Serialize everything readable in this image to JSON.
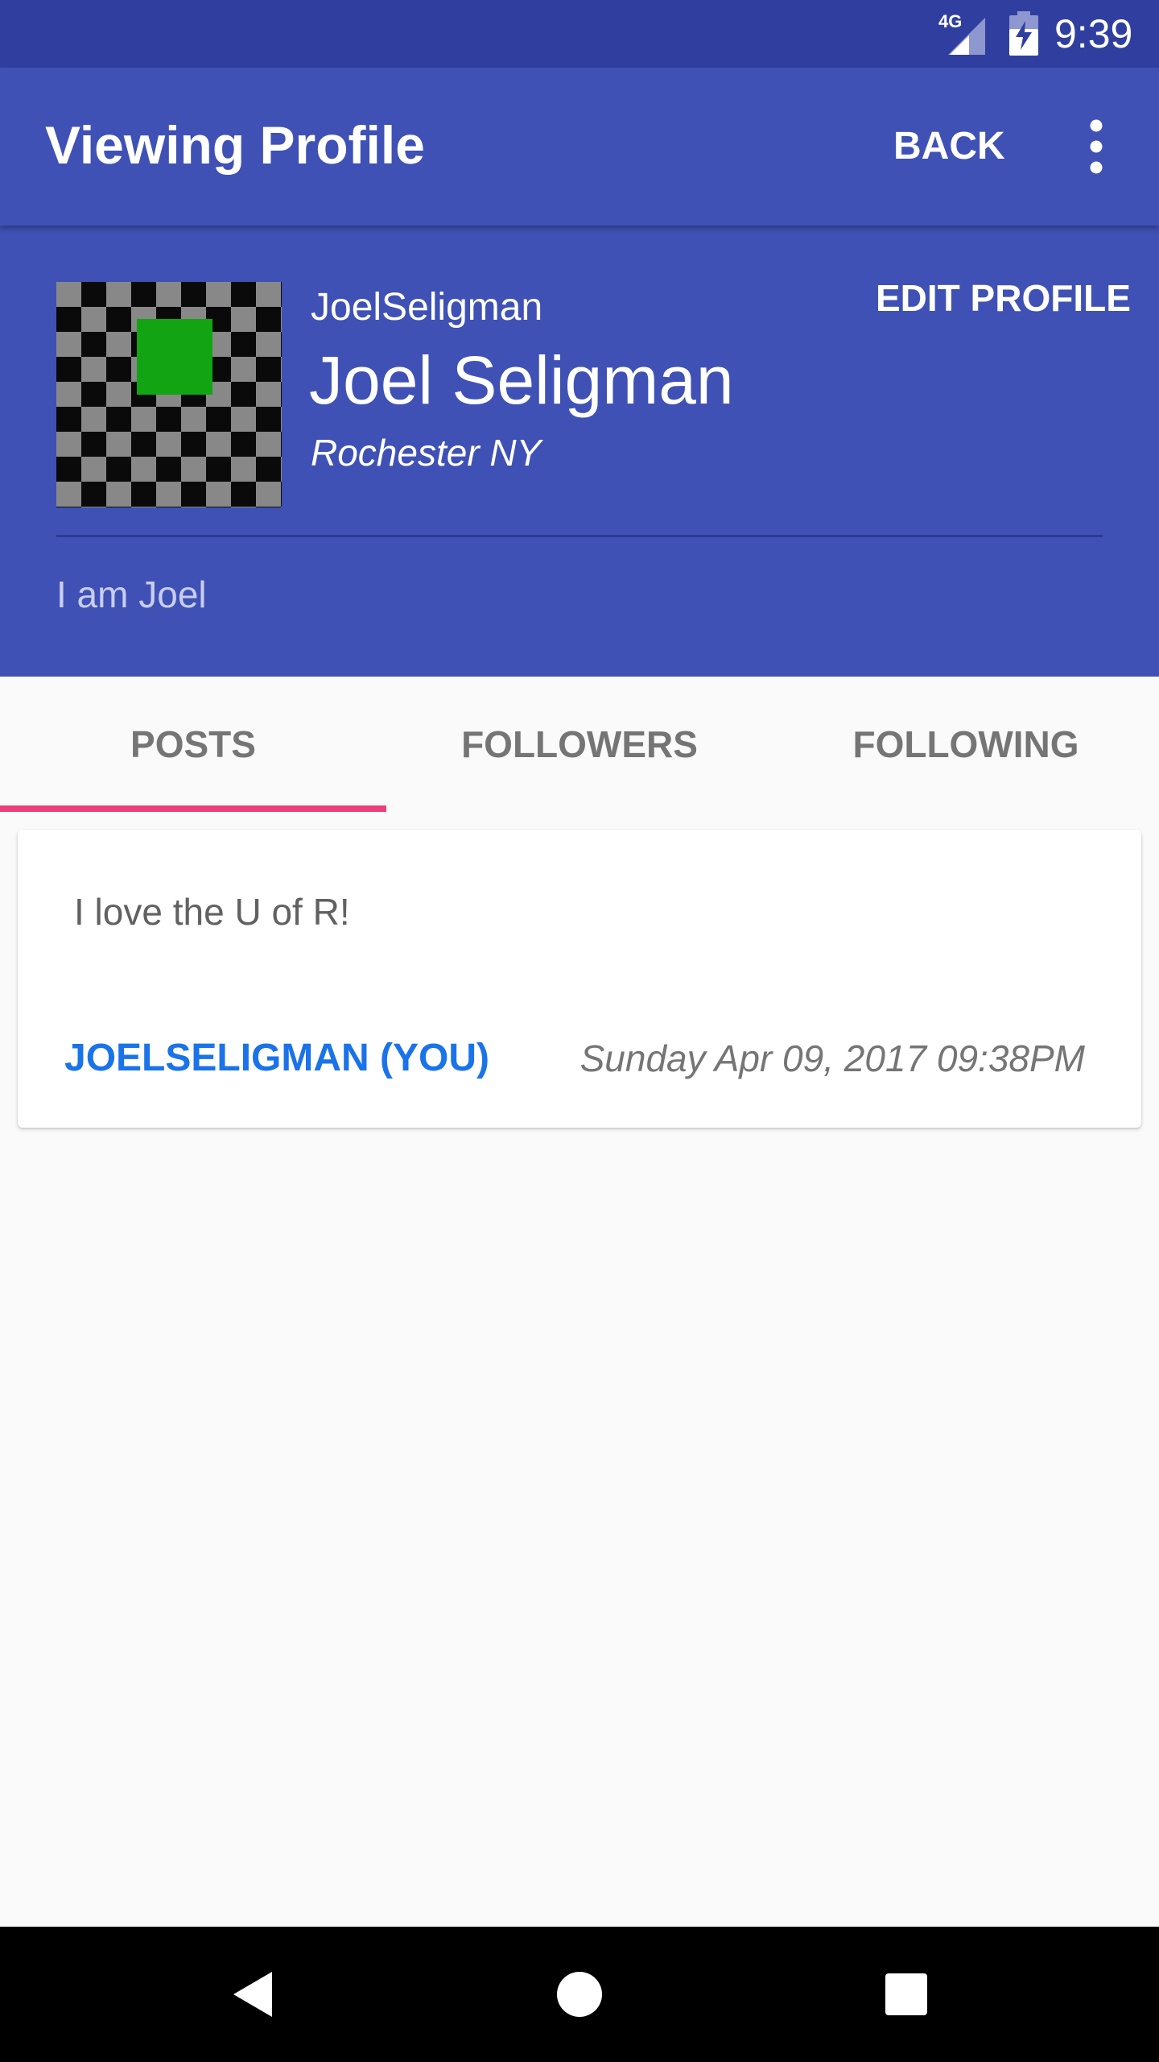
{
  "status_bar": {
    "network": "4G",
    "time": "9:39"
  },
  "app_bar": {
    "title": "Viewing Profile",
    "back_label": "BACK",
    "menu_icon": "more-vert-icon"
  },
  "profile": {
    "username": "JoelSeligman",
    "full_name": "Joel Seligman",
    "location": "Rochester NY",
    "edit_label": "EDIT PROFILE",
    "bio": "I am Joel"
  },
  "tabs": [
    {
      "label": "POSTS",
      "selected": true
    },
    {
      "label": "FOLLOWERS",
      "selected": false
    },
    {
      "label": "FOLLOWING",
      "selected": false
    }
  ],
  "posts": [
    {
      "text": "I love the U of R!",
      "author": "JOELSELIGMAN (YOU)",
      "date": "Sunday Apr 09, 2017 09:38PM"
    }
  ],
  "nav_bar": {
    "back_icon": "nav-back-icon",
    "home_icon": "nav-home-icon",
    "recents_icon": "nav-recents-icon"
  },
  "colors": {
    "primary": "#3f51b5",
    "primary_dark": "#303f9f",
    "accent": "#ec407a",
    "link": "#1a73e8"
  }
}
